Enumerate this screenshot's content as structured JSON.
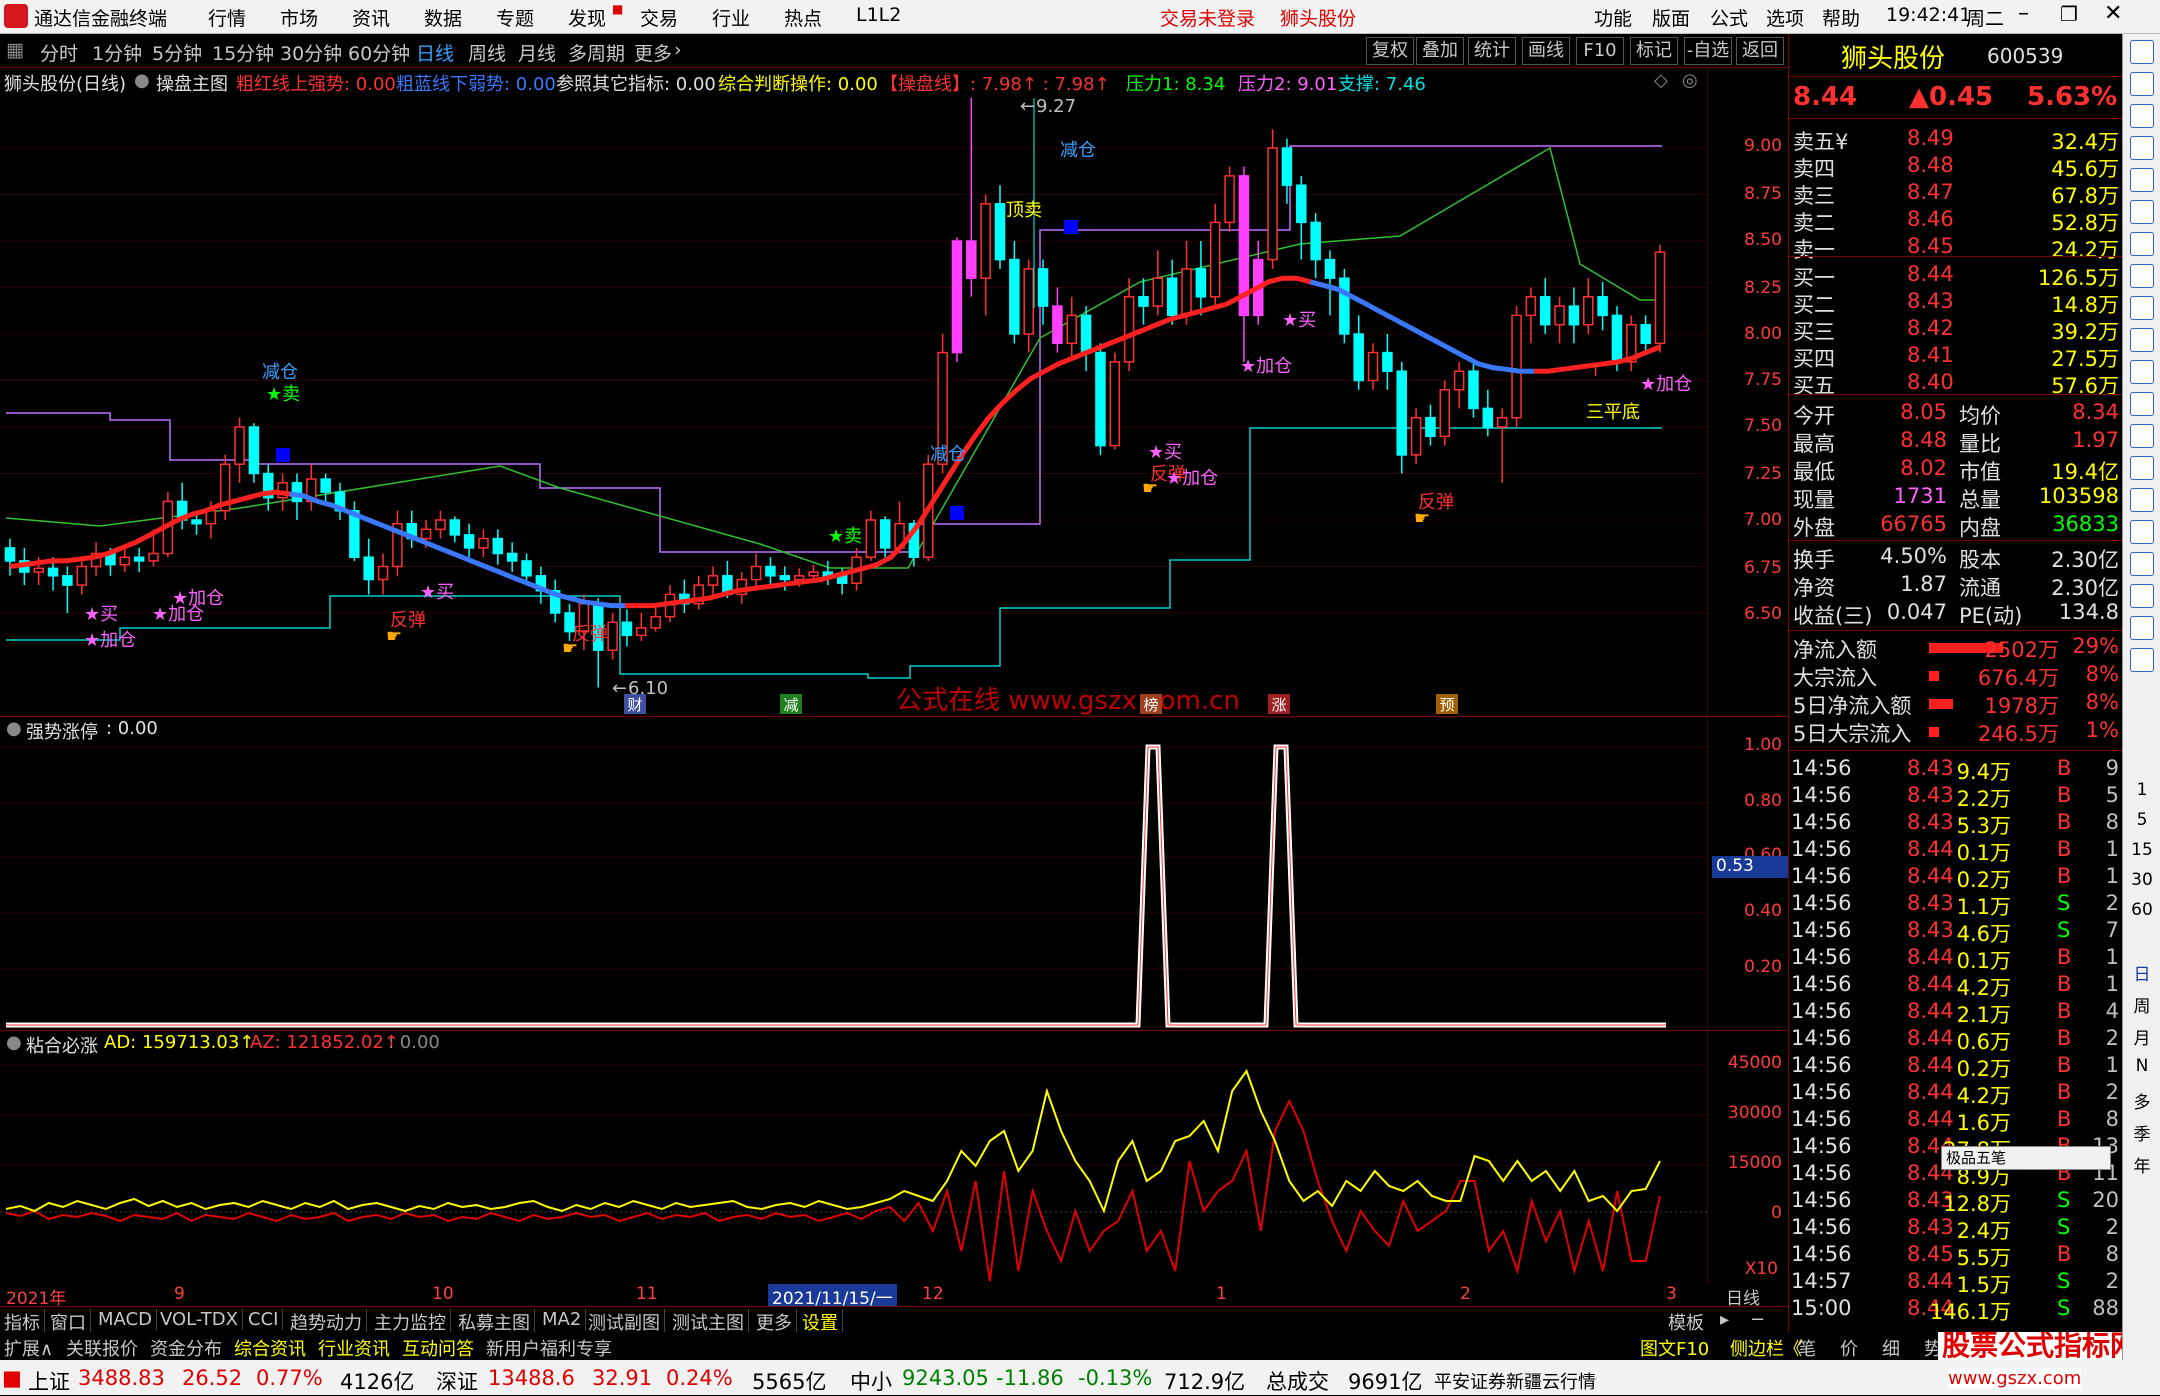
{
  "titlebar": {
    "app": "通达信金融终端",
    "menus": [
      "行情",
      "市场",
      "资讯",
      "数据",
      "专题",
      "发现",
      "交易",
      "行业",
      "热点",
      "L1L2"
    ],
    "login": "交易未登录",
    "stock": "狮头股份",
    "right_menus": [
      "功能",
      "版面",
      "公式",
      "选项",
      "帮助"
    ],
    "time": "19:42:41",
    "weekday": "周二"
  },
  "periods": {
    "items": [
      "分时",
      "1分钟",
      "5分钟",
      "15分钟",
      "30分钟",
      "60分钟",
      "日线",
      "周线",
      "月线",
      "多周期",
      "更多"
    ],
    "active": "日线",
    "tools": [
      "复权",
      "叠加",
      "统计",
      "画线",
      "F10",
      "标记",
      "-自选",
      "返回"
    ]
  },
  "main_pane": {
    "stock_label": "狮头股份(日线)",
    "indicator": "操盘主图",
    "params": [
      {
        "t": "粗红线上强势: 0.00",
        "c": "#ff3030"
      },
      {
        "t": "粗蓝线下弱势: 0.00",
        "c": "#3a78ff"
      },
      {
        "t": "参照其它指标: 0.00",
        "c": "#e0e0e0"
      },
      {
        "t": "综合判断操作: 0.00",
        "c": "#ffff00"
      },
      {
        "t": "【操盘线】: 7.98↑ : 7.98↑",
        "c": "#ff3030"
      },
      {
        "t": "压力1: 8.34",
        "c": "#00ff00"
      },
      {
        "t": "压力2: 9.01",
        "c": "#ff60ff"
      },
      {
        "t": "支撑: 7.46",
        "c": "#00e0e0"
      }
    ],
    "axis": [
      "9.00",
      "8.75",
      "8.50",
      "8.25",
      "8.00",
      "7.75",
      "7.50",
      "7.25",
      "7.00",
      "6.75",
      "6.50"
    ],
    "watermark": "公式在线 www.gszx.com.cn",
    "high_label": "9.27",
    "low_label": "6.10",
    "bottom_tags": [
      "财",
      "减",
      "榜",
      "涨",
      "预"
    ],
    "annotations": [
      {
        "t": "减仓",
        "c": "#3aa0ff"
      },
      {
        "t": "★卖",
        "c": "#00ff00"
      },
      {
        "t": "★买",
        "c": "#ff60ff"
      },
      {
        "t": "★加仓",
        "c": "#ff60ff"
      },
      {
        "t": "★加仓",
        "c": "#ff60ff"
      },
      {
        "t": "★加仓",
        "c": "#ff60ff"
      },
      {
        "t": "反弹",
        "c": "#ff3030"
      },
      {
        "t": "★买",
        "c": "#ff60ff"
      },
      {
        "t": "反弹",
        "c": "#ff3030"
      },
      {
        "t": "★卖",
        "c": "#00ff00"
      },
      {
        "t": "减仓",
        "c": "#3aa0ff"
      },
      {
        "t": "顶卖",
        "c": "#ffff00"
      },
      {
        "t": "减仓",
        "c": "#3aa0ff"
      },
      {
        "t": "★买",
        "c": "#ff60ff"
      },
      {
        "t": "反弹",
        "c": "#ff3030"
      },
      {
        "t": "★加仓",
        "c": "#ff60ff"
      },
      {
        "t": "★加仓",
        "c": "#ff60ff"
      },
      {
        "t": "★买",
        "c": "#ff60ff"
      },
      {
        "t": "反弹",
        "c": "#ff3030"
      },
      {
        "t": "三平底",
        "c": "#ffff00"
      },
      {
        "t": "★加仓",
        "c": "#ff60ff"
      }
    ]
  },
  "pane2": {
    "title": "强势涨停",
    "value": ": 0.00",
    "axis": [
      "1.00",
      "0.80",
      "0.60",
      "0.40",
      "0.20"
    ],
    "cursor": "0.53"
  },
  "pane3": {
    "title": "粘合必涨",
    "ad": "AD: 159713.03↑",
    "az": "AZ: 121852.02↑",
    "val": ": 0.00",
    "axis": [
      "45000",
      "30000",
      "15000",
      "0"
    ],
    "mult": "X10"
  },
  "datebar": {
    "labels": [
      "2021年",
      "9",
      "10",
      "11",
      "12",
      "1",
      "2",
      "3"
    ],
    "cursor_date": "2021/11/15/一",
    "unit": "日线"
  },
  "bottom_tabs": [
    "指标",
    "窗口",
    "MACD",
    "VOL-TDX",
    "CCI",
    "趋势动力",
    "主力监控",
    "私募主图",
    "MA2",
    "测试副图",
    "测试主图",
    "更多",
    "设置"
  ],
  "bottom_right": "模板",
  "bottom_bar2": {
    "items": [
      {
        "t": "扩展∧",
        "c": "#c8c8c8"
      },
      {
        "t": "关联报价",
        "c": "#c8c8c8"
      },
      {
        "t": "资金分布",
        "c": "#c8c8c8"
      },
      {
        "t": "综合资讯",
        "c": "#ffff00"
      },
      {
        "t": "行业资讯",
        "c": "#ffff00"
      },
      {
        "t": "互动问答",
        "c": "#ffff00"
      },
      {
        "t": "新用户福利专享",
        "c": "#c8c8c8"
      }
    ],
    "right": [
      "图文F10",
      "侧边栏《"
    ],
    "tabs": [
      "笔",
      "价",
      "细",
      "势"
    ],
    "brand": "股票公式指标网",
    "brand_url": "www.gszx.com"
  },
  "ticker": {
    "sh_name": "上证",
    "sh_val": "3488.83",
    "sh_chg": "26.52",
    "sh_pct": "0.77%",
    "sh_amt": "4126亿",
    "sz_name": "深证",
    "sz_val": "13488.6",
    "sz_chg": "32.91",
    "sz_pct": "0.24%",
    "sz_amt": "5565亿",
    "zx_name": "中小",
    "zx_val": "9243.05",
    "zx_chg": "-11.86",
    "zx_pct": "-0.13%",
    "zx_amt": "712.9亿",
    "total_name": "总成交",
    "total_amt": "9691亿",
    "broker": "平安证券新疆云行情"
  },
  "quote": {
    "name": "狮头股份",
    "code": "600539",
    "price": "8.44",
    "change": "▲0.45",
    "pct": "5.63%",
    "asks": [
      {
        "l": "卖五¥",
        "p": "8.49",
        "v": "32.4万"
      },
      {
        "l": "卖四",
        "p": "8.48",
        "v": "45.6万"
      },
      {
        "l": "卖三",
        "p": "8.47",
        "v": "67.8万"
      },
      {
        "l": "卖二",
        "p": "8.46",
        "v": "52.8万"
      },
      {
        "l": "卖一",
        "p": "8.45",
        "v": "24.2万"
      }
    ],
    "bids": [
      {
        "l": "买一",
        "p": "8.44",
        "v": "126.5万"
      },
      {
        "l": "买二",
        "p": "8.43",
        "v": "14.8万"
      },
      {
        "l": "买三",
        "p": "8.42",
        "v": "39.2万"
      },
      {
        "l": "买四",
        "p": "8.41",
        "v": "27.5万"
      },
      {
        "l": "买五",
        "p": "8.40",
        "v": "57.6万"
      }
    ],
    "stats": [
      [
        "今开",
        "8.05",
        "均价",
        "8.34"
      ],
      [
        "最高",
        "8.48",
        "量比",
        "1.97"
      ],
      [
        "最低",
        "8.02",
        "市值",
        "19.4亿"
      ],
      [
        "现量",
        "1731",
        "总量",
        "103598"
      ],
      [
        "外盘",
        "66765",
        "内盘",
        "36833"
      ]
    ],
    "stats2": [
      [
        "换手",
        "4.50%",
        "股本",
        "2.30亿"
      ],
      [
        "净资",
        "1.87",
        "流通",
        "2.30亿"
      ],
      [
        "收益(三)",
        "0.047",
        "PE(动)",
        "134.8"
      ]
    ],
    "flows": [
      [
        "净流入额",
        "2502万",
        "29%"
      ],
      [
        "大宗流入",
        "676.4万",
        "8%"
      ],
      [
        "5日净流入额",
        "1978万",
        "8%"
      ],
      [
        "5日大宗流入",
        "246.5万",
        "1%"
      ]
    ],
    "ticks": [
      [
        "14:56",
        "8.43",
        "9.4万",
        "B",
        "9"
      ],
      [
        "14:56",
        "8.43",
        "2.2万",
        "B",
        "5"
      ],
      [
        "14:56",
        "8.43",
        "5.3万",
        "B",
        "8"
      ],
      [
        "14:56",
        "8.44",
        "0.1万",
        "B",
        "1"
      ],
      [
        "14:56",
        "8.44",
        "0.2万",
        "B",
        "1"
      ],
      [
        "14:56",
        "8.43",
        "1.1万",
        "S",
        "2"
      ],
      [
        "14:56",
        "8.43",
        "4.6万",
        "S",
        "7"
      ],
      [
        "14:56",
        "8.44",
        "0.1万",
        "B",
        "1"
      ],
      [
        "14:56",
        "8.44",
        "4.2万",
        "B",
        "1"
      ],
      [
        "14:56",
        "8.44",
        "2.1万",
        "B",
        "4"
      ],
      [
        "14:56",
        "8.44",
        "0.6万",
        "B",
        "2"
      ],
      [
        "14:56",
        "8.44",
        "0.2万",
        "B",
        "1"
      ],
      [
        "14:56",
        "8.44",
        "4.2万",
        "B",
        "2"
      ],
      [
        "14:56",
        "8.44",
        "1.6万",
        "B",
        "8"
      ],
      [
        "14:56",
        "8.44",
        "27.8万",
        "B",
        "13"
      ],
      [
        "14:56",
        "8.44",
        "8.9万",
        "B",
        "11"
      ],
      [
        "14:56",
        "8.43",
        "12.8万",
        "S",
        "20"
      ],
      [
        "14:56",
        "8.43",
        "2.4万",
        "S",
        "2"
      ],
      [
        "14:56",
        "8.45",
        "5.5万",
        "B",
        "8"
      ],
      [
        "14:57",
        "8.44",
        "1.5万",
        "S",
        "2"
      ],
      [
        "15:00",
        "8.44",
        "146.1万",
        "S",
        "88"
      ]
    ],
    "popup": "极品五笔"
  },
  "sidebar": {
    "items": [
      "日",
      "周",
      "月",
      "N",
      "多",
      "季",
      "年"
    ],
    "nums": [
      "1",
      "5",
      "15",
      "30",
      "60"
    ]
  },
  "colors": {
    "up": "#ff3030",
    "down": "#00ffff",
    "accent": "#ff3030",
    "blue": "#3a78ff"
  }
}
